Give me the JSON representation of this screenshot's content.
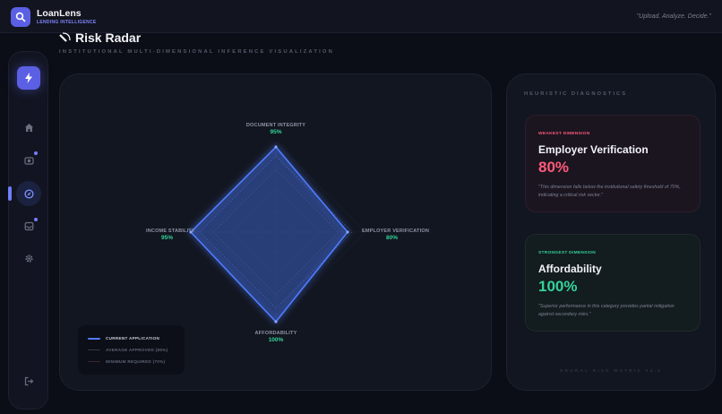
{
  "app": {
    "name": "LoanLens",
    "subtitle": "LENDING INTELLIGENCE",
    "tagline": "\"Upload. Analyze. Decide.\""
  },
  "sidebar": {
    "items": [
      {
        "icon": "bolt-icon",
        "active": false
      },
      {
        "icon": "home-icon",
        "active": false
      },
      {
        "icon": "camera-icon",
        "active": false,
        "badge": true
      },
      {
        "icon": "compass-icon",
        "active": true
      },
      {
        "icon": "inbox-icon",
        "active": false,
        "badge": true
      },
      {
        "icon": "gear-icon",
        "active": false
      },
      {
        "icon": "logout-icon",
        "active": false
      }
    ]
  },
  "page": {
    "title": "Risk Radar",
    "subtitle": "INSTITUTIONAL MULTI-DIMENSIONAL INFERENCE VISUALIZATION"
  },
  "chart_data": {
    "type": "radar",
    "axes": [
      "DOCUMENT INTEGRITY",
      "EMPLOYER VERIFICATION",
      "AFFORDABILITY",
      "INCOME STABILITY"
    ],
    "value_labels": [
      "95%",
      "80%",
      "100%",
      "95%"
    ],
    "series": [
      {
        "name": "CURRENT APPLICATION",
        "values": [
          95,
          80,
          100,
          95
        ],
        "color": "#4f7cff"
      },
      {
        "name": "AVERAGE APPROVED (85%)",
        "values": [
          85,
          85,
          85,
          85
        ],
        "color": "#3a4870"
      },
      {
        "name": "MINIMUM REQUIRED (70%)",
        "values": [
          70,
          70,
          70,
          70
        ],
        "color": "#4a3040"
      }
    ],
    "rmax": 100
  },
  "diagnostics": {
    "heading": "HEURISTIC DIAGNOSTICS",
    "weakest": {
      "tag": "WEAKEST DIMENSION",
      "title": "Employer Verification",
      "value": "80%",
      "description": "\"This dimension falls below the institutional safety threshold of 70%, indicating a critical risk vector.\"",
      "color": "#ff5a7a"
    },
    "strongest": {
      "tag": "STRONGEST DIMENSION",
      "title": "Affordability",
      "value": "100%",
      "description": "\"Superior performance in this category provides partial mitigation against secondary risks.\"",
      "color": "#34d399"
    },
    "footer": "NEURAL RISK MATRIX V4.2"
  }
}
